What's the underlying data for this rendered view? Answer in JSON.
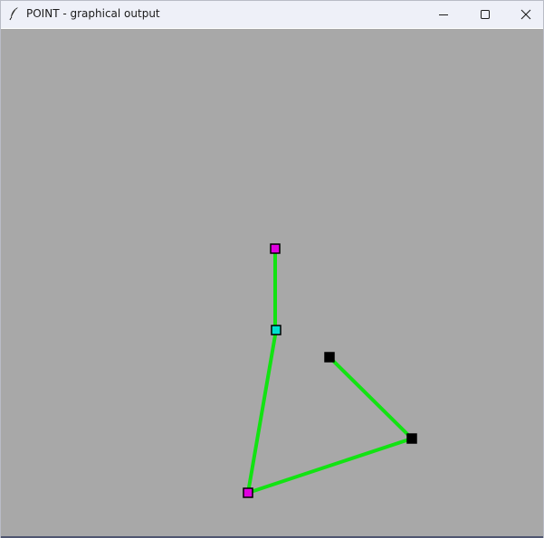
{
  "window": {
    "title": "POINT - graphical output",
    "app_icon": "feather-icon",
    "controls": [
      "minimize-icon",
      "maximize-icon",
      "close-icon"
    ]
  },
  "canvas": {
    "background_color": "#a8a8a8",
    "line_color": "#12e312",
    "points": [
      {
        "name": "magenta-top",
        "fill": "#e000e0"
      },
      {
        "name": "cyan-middle",
        "fill": "#00e0d0"
      },
      {
        "name": "black-upper",
        "fill": "#000000"
      },
      {
        "name": "black-lower",
        "fill": "#000000"
      },
      {
        "name": "magenta-bottom",
        "fill": "#e000e0"
      }
    ]
  }
}
